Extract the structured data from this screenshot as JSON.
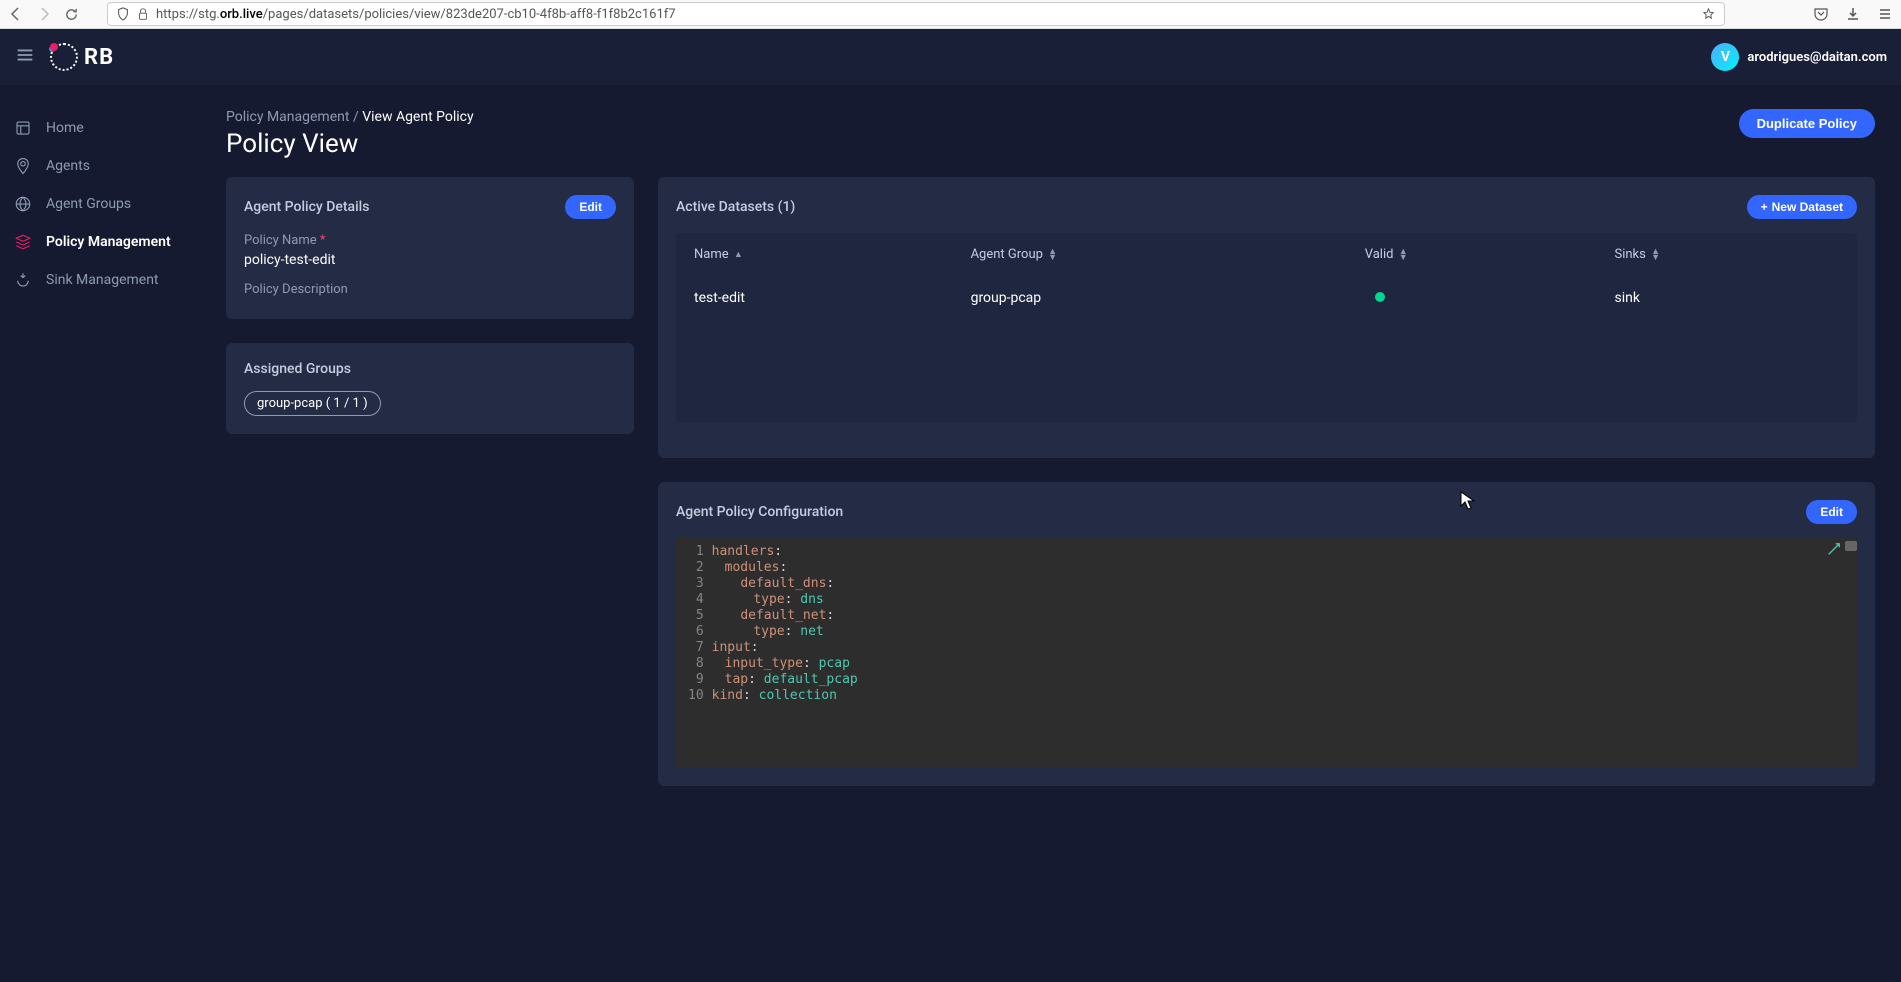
{
  "browser": {
    "url_prefix": "https://stg.",
    "url_bold": "orb.live",
    "url_suffix": "/pages/datasets/policies/view/823de207-cb10-4f8b-aff8-f1f8b2c161f7"
  },
  "header": {
    "logo_text": "RB",
    "user": "arodrigues@daitan.com",
    "avatar_letter": "V"
  },
  "sidebar": {
    "items": [
      {
        "label": "Home",
        "active": false
      },
      {
        "label": "Agents",
        "active": false
      },
      {
        "label": "Agent Groups",
        "active": false
      },
      {
        "label": "Policy Management",
        "active": true
      },
      {
        "label": "Sink Management",
        "active": false
      }
    ]
  },
  "breadcrumb": {
    "root": "Policy Management",
    "sep": "/",
    "current": "View Agent Policy"
  },
  "page_title": "Policy View",
  "actions": {
    "duplicate": "Duplicate Policy",
    "edit1": "Edit",
    "new_dataset": "New Dataset",
    "edit2": "Edit"
  },
  "details": {
    "card_title": "Agent Policy Details",
    "name_label": "Policy Name",
    "name_req": "*",
    "name_value": "policy-test-edit",
    "desc_label": "Policy Description"
  },
  "assigned": {
    "card_title": "Assigned Groups",
    "chip": "group-pcap ( 1 / 1 )"
  },
  "datasets": {
    "card_title": "Active Datasets (1)",
    "cols": {
      "name": "Name",
      "group": "Agent Group",
      "valid": "Valid",
      "sinks": "Sinks"
    },
    "rows": [
      {
        "name": "test-edit",
        "group": "group-pcap",
        "valid": true,
        "sinks": "sink"
      }
    ]
  },
  "config": {
    "card_title": "Agent Policy Configuration",
    "lines": [
      {
        "n": 1,
        "indent": 0,
        "guide": 0,
        "key": "handlers",
        "val": ""
      },
      {
        "n": 2,
        "indent": 1,
        "guide": 1,
        "key": "modules",
        "val": ""
      },
      {
        "n": 3,
        "indent": 2,
        "guide": 1,
        "key": "default_dns",
        "val": ""
      },
      {
        "n": 4,
        "indent": 3,
        "guide": 2,
        "key": "type",
        "val": "dns"
      },
      {
        "n": 5,
        "indent": 2,
        "guide": 1,
        "key": "default_net",
        "val": ""
      },
      {
        "n": 6,
        "indent": 3,
        "guide": 2,
        "key": "type",
        "val": "net"
      },
      {
        "n": 7,
        "indent": 0,
        "guide": 0,
        "key": "input",
        "val": ""
      },
      {
        "n": 8,
        "indent": 1,
        "guide": 1,
        "key": "input_type",
        "val": "pcap"
      },
      {
        "n": 9,
        "indent": 1,
        "guide": 1,
        "key": "tap",
        "val": "default_pcap"
      },
      {
        "n": 10,
        "indent": 0,
        "guide": 0,
        "key": "kind",
        "val": "collection"
      }
    ]
  }
}
